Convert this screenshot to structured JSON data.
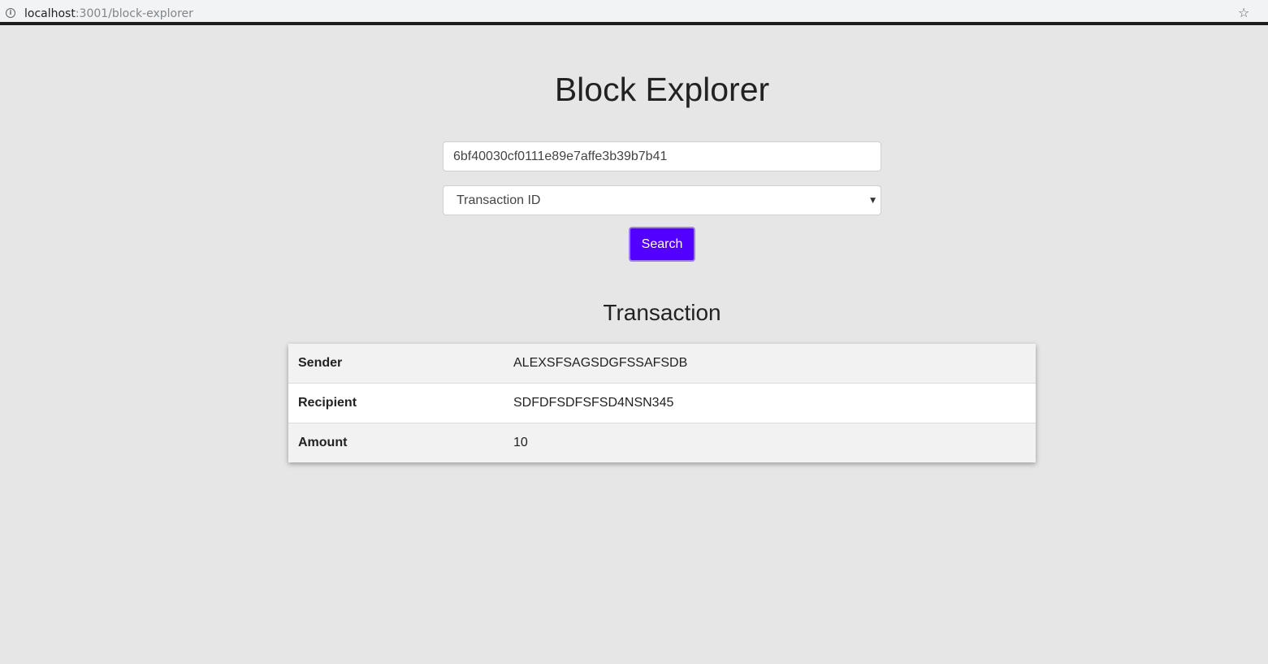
{
  "browser": {
    "url_host": "localhost",
    "url_path": ":3001/block-explorer",
    "info_icon": "info-icon",
    "bookmark_icon": "star-icon"
  },
  "page": {
    "title": "Block Explorer"
  },
  "search": {
    "value": "6bf40030cf0111e89e7affe3b39b7b41",
    "type_selected": "Transaction ID",
    "button_label": "Search",
    "button_color": "#5200ff"
  },
  "result": {
    "title": "Transaction",
    "rows": [
      {
        "label": "Sender",
        "value": "ALEXSFSAGSDGFSSAFSDB"
      },
      {
        "label": "Recipient",
        "value": "SDFDFSDFSFSD4NSN345"
      },
      {
        "label": "Amount",
        "value": "10"
      }
    ]
  }
}
